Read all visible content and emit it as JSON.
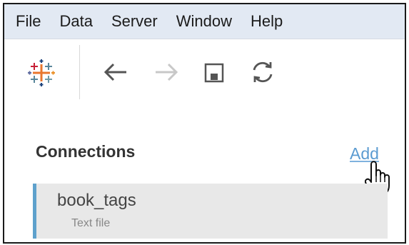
{
  "menu": {
    "items": [
      {
        "label": "File"
      },
      {
        "label": "Data"
      },
      {
        "label": "Server"
      },
      {
        "label": "Window"
      },
      {
        "label": "Help"
      }
    ]
  },
  "toolbar": {
    "logo_icon": "tableau-logo-icon",
    "buttons": [
      {
        "name": "back",
        "icon": "arrow-left-icon",
        "enabled": true
      },
      {
        "name": "forward",
        "icon": "arrow-right-icon",
        "enabled": false
      },
      {
        "name": "save",
        "icon": "save-icon",
        "enabled": true
      },
      {
        "name": "refresh",
        "icon": "refresh-icon",
        "enabled": true
      }
    ]
  },
  "connections": {
    "title": "Connections",
    "add_label": "Add",
    "items": [
      {
        "name": "book_tags",
        "type": "Text file"
      }
    ]
  },
  "colors": {
    "menubar_bg": "#e2e9f3",
    "link": "#5b9bd1",
    "selection_accent": "#5ea1cc"
  }
}
